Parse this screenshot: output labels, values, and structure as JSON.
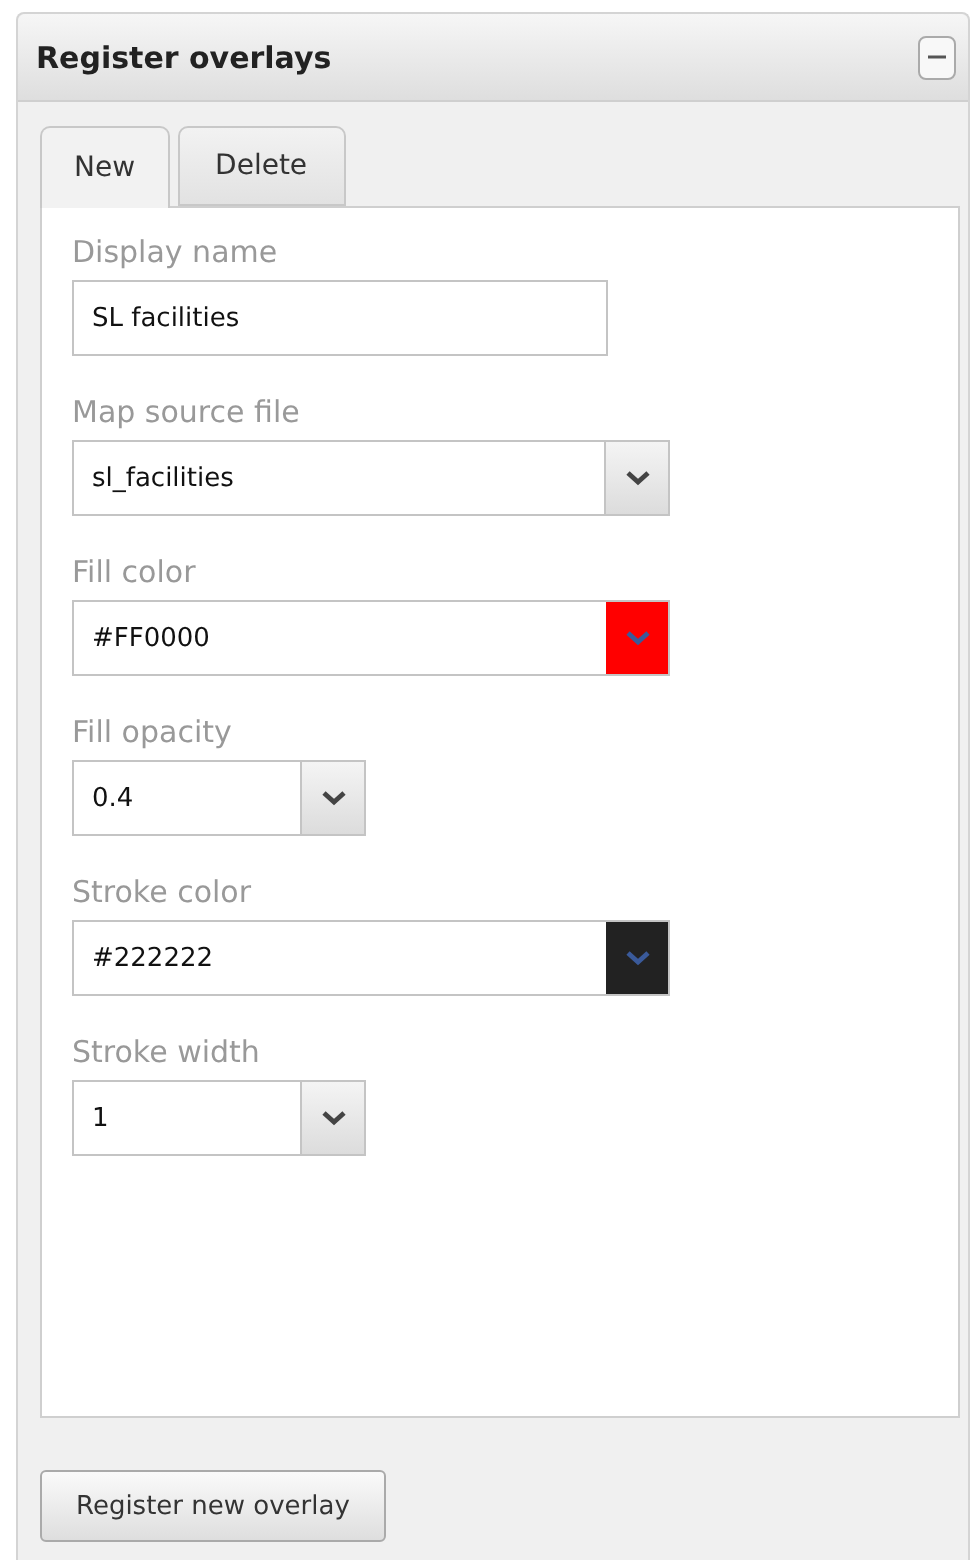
{
  "panel": {
    "title": "Register overlays",
    "collapsed": false
  },
  "tabs": [
    {
      "label": "New",
      "selected": true
    },
    {
      "label": "Delete",
      "selected": false
    }
  ],
  "fields": [
    {
      "label": "Display name",
      "kind": "text",
      "value": "SL facilities"
    },
    {
      "label": "Map source file",
      "kind": "select",
      "value": "sl_facilities"
    },
    {
      "label": "Fill color",
      "kind": "color",
      "value": "#FF0000",
      "color": "#ff0000"
    },
    {
      "label": "Fill opacity",
      "kind": "short-select",
      "value": "0.4"
    },
    {
      "label": "Stroke color",
      "kind": "color",
      "value": "#222222",
      "color": "#222222"
    },
    {
      "label": "Stroke width",
      "kind": "short-select",
      "value": "1"
    }
  ],
  "submit": {
    "label": "Register new overlay"
  }
}
